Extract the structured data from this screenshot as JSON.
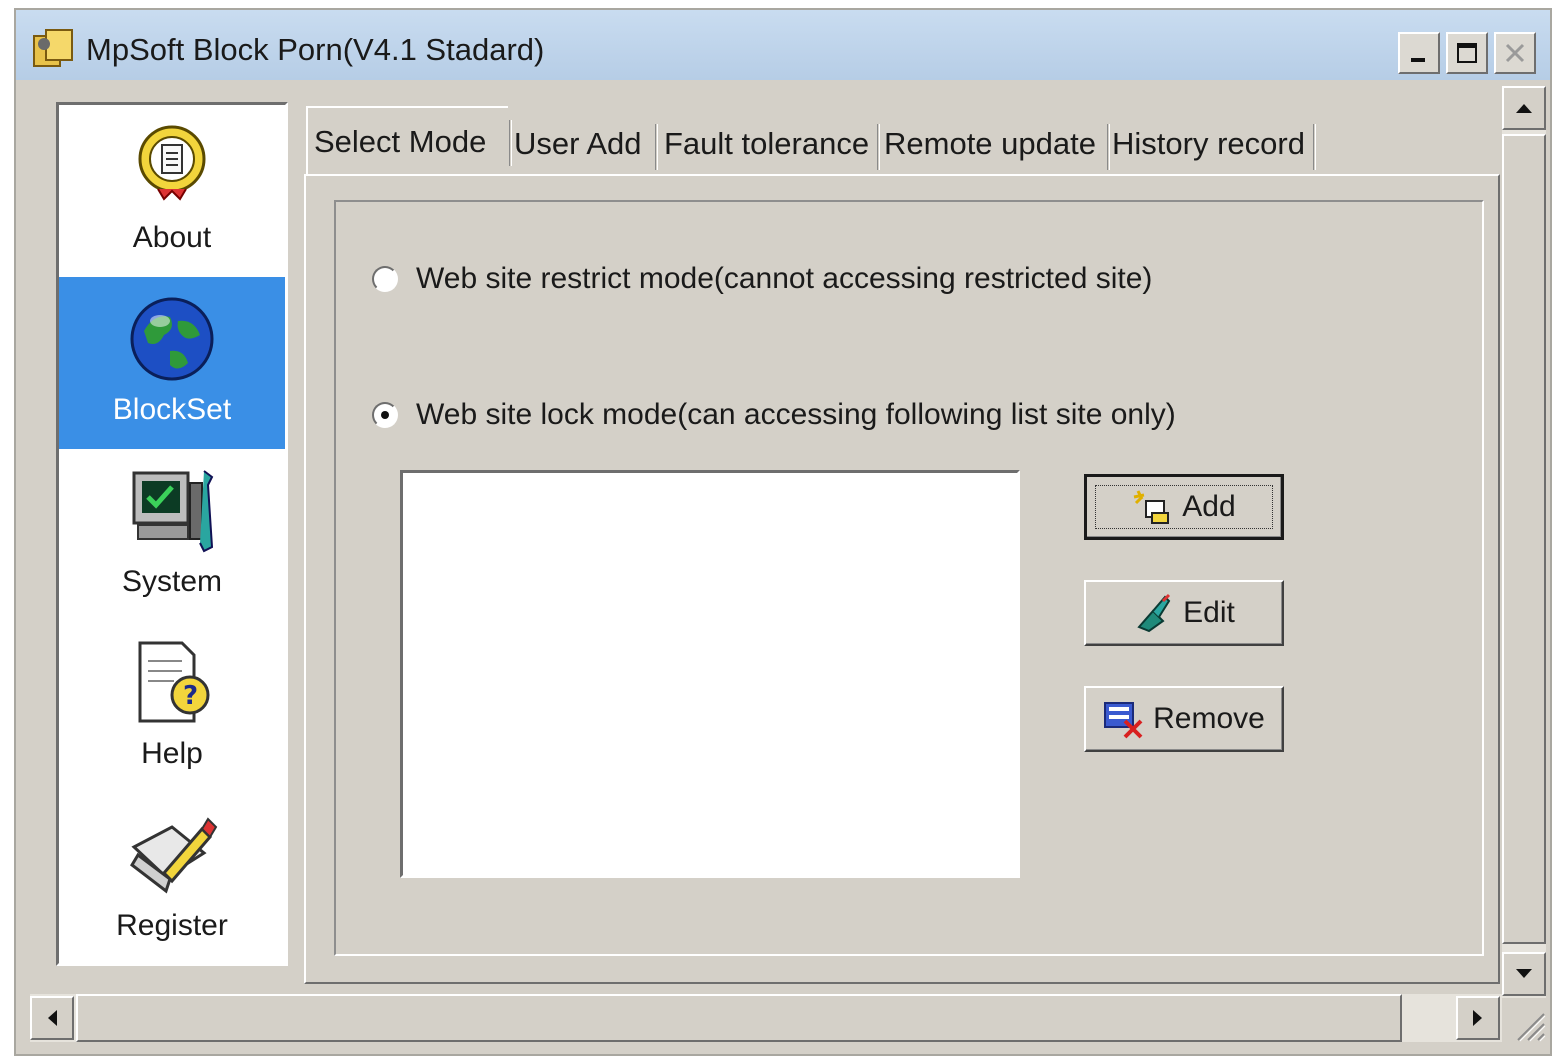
{
  "window": {
    "title": "MpSoft Block Porn(V4.1 Stadard)",
    "minimize_icon": "minimize-icon",
    "maximize_icon": "maximize-icon",
    "close_icon": "close-icon"
  },
  "nav": {
    "items": [
      {
        "label": "About",
        "icon": "about-icon",
        "active": false
      },
      {
        "label": "BlockSet",
        "icon": "globe-icon",
        "active": true
      },
      {
        "label": "System",
        "icon": "computer-icon",
        "active": false
      },
      {
        "label": "Help",
        "icon": "help-document-icon",
        "active": false
      },
      {
        "label": "Register",
        "icon": "register-pen-icon",
        "active": false
      }
    ]
  },
  "tabs": [
    {
      "label": "Select Mode",
      "active": true
    },
    {
      "label": "User Add",
      "active": false
    },
    {
      "label": "Fault tolerance",
      "active": false
    },
    {
      "label": "Remote update",
      "active": false
    },
    {
      "label": "History record",
      "active": false
    }
  ],
  "select_mode": {
    "restrict_label": "Web site restrict mode(cannot accessing restricted site)",
    "restrict_checked": false,
    "lock_label": "Web site lock mode(can accessing following list site only)",
    "lock_checked": true,
    "site_list": [],
    "add_label": "Add",
    "edit_label": "Edit",
    "remove_label": "Remove"
  },
  "colors": {
    "face": "#d4d0c8",
    "nav_active": "#3a8fe6",
    "titlebar": "#c9dcf0"
  }
}
